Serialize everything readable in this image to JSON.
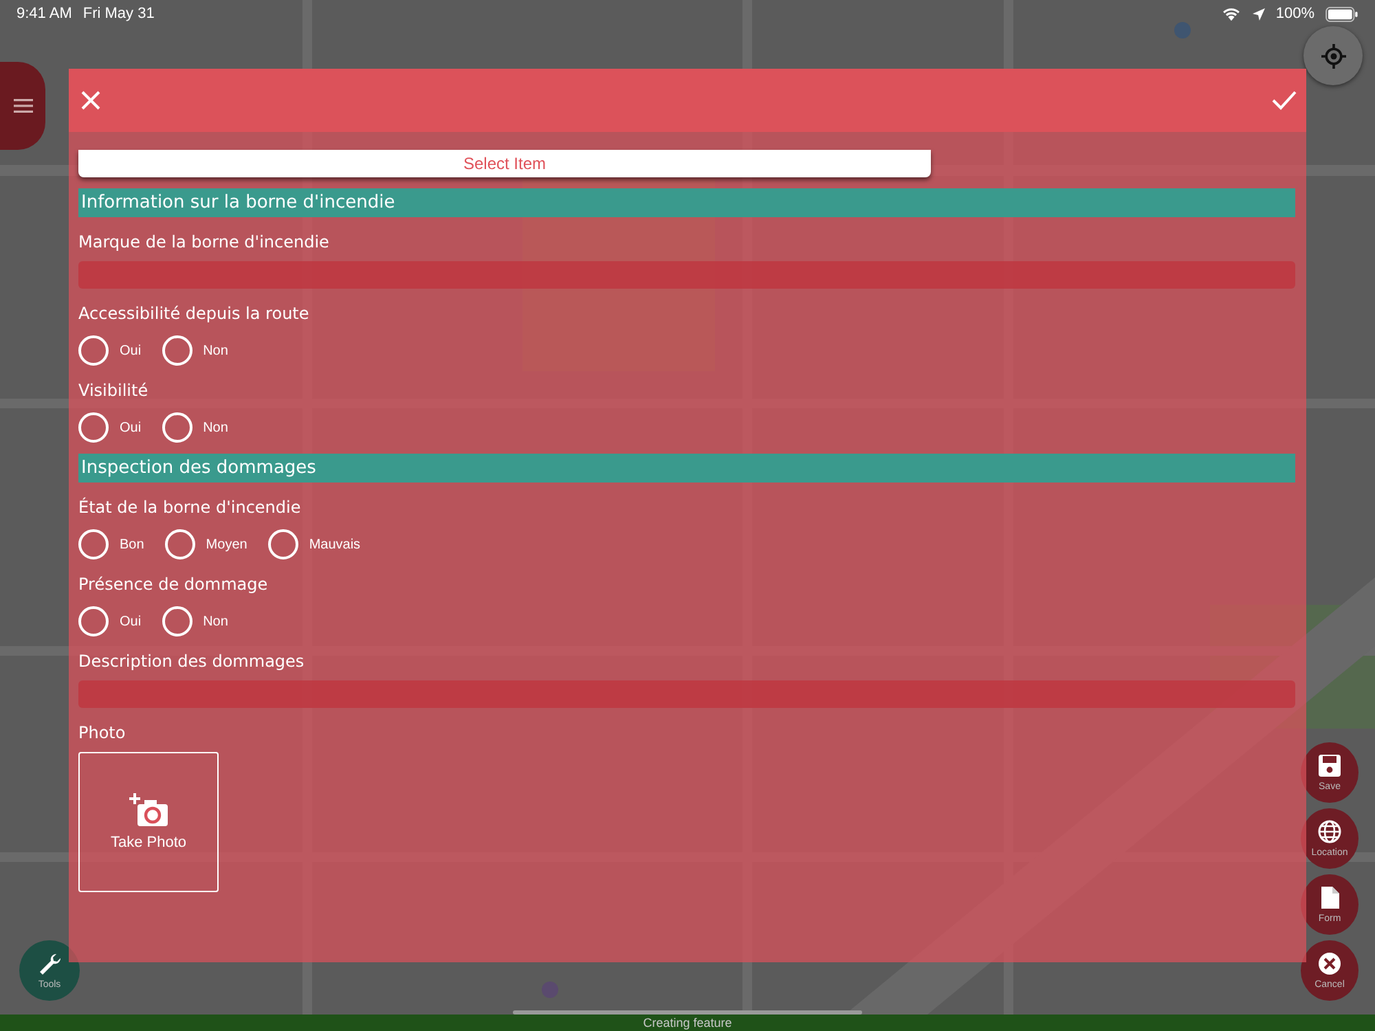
{
  "status_bar": {
    "time": "9:41 AM",
    "date": "Fri May 31",
    "battery": "100%"
  },
  "modal": {
    "items": [
      {
        "kind": "select",
        "label": "Select Item"
      },
      {
        "kind": "header",
        "label": "Information sur la borne d'incendie"
      },
      {
        "kind": "text",
        "label": "Marque de la borne d'incendie"
      },
      {
        "kind": "radio",
        "label": "Accessibilité depuis la route",
        "options": [
          {
            "label": "Oui",
            "selected": false
          },
          {
            "label": "Non",
            "selected": false
          }
        ]
      },
      {
        "kind": "radio",
        "label": "Visibilité",
        "options": [
          {
            "label": "Oui",
            "selected": false
          },
          {
            "label": "Non",
            "selected": false
          }
        ]
      },
      {
        "kind": "header",
        "label": "Inspection des dommages"
      },
      {
        "kind": "radio",
        "label": "État de la borne d'incendie",
        "options": [
          {
            "label": "Bon",
            "selected": false
          },
          {
            "label": "Moyen",
            "selected": false
          },
          {
            "label": "Mauvais",
            "selected": false
          }
        ]
      },
      {
        "kind": "radio",
        "label": "Présence de dommage",
        "options": [
          {
            "label": "Oui",
            "selected": false
          },
          {
            "label": "Non",
            "selected": false
          }
        ]
      },
      {
        "kind": "text",
        "label": "Description des dommages"
      },
      {
        "label": "Photo",
        "button": "Take Photo"
      }
    ]
  },
  "side_buttons": [
    {
      "kind": "save",
      "label": "Save"
    },
    {
      "kind": "location",
      "label": "Location"
    },
    {
      "kind": "form",
      "label": "Form"
    },
    {
      "kind": "cancel",
      "label": "Cancel"
    }
  ],
  "tools_button": {
    "label": "Tools"
  },
  "bottom_bar": {
    "text": "Creating feature"
  }
}
